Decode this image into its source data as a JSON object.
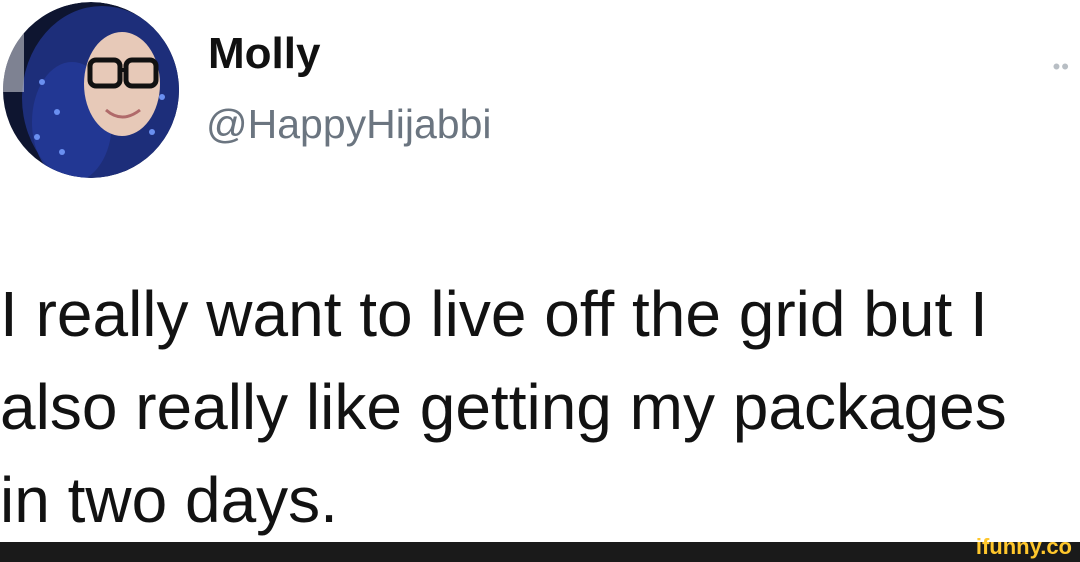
{
  "tweet": {
    "display_name": "Molly",
    "handle": "@HappyHijabbi",
    "more_icon": "more-dots-icon",
    "text": "I really want to live off the grid but I\nalso really like getting my packages\nin two days."
  },
  "watermark": {
    "text": "ifunny.co"
  },
  "colors": {
    "name": "#111111",
    "handle": "#6b7580",
    "body": "#121212",
    "footer": "#1a1a1a",
    "watermark": "#ffc72c"
  }
}
